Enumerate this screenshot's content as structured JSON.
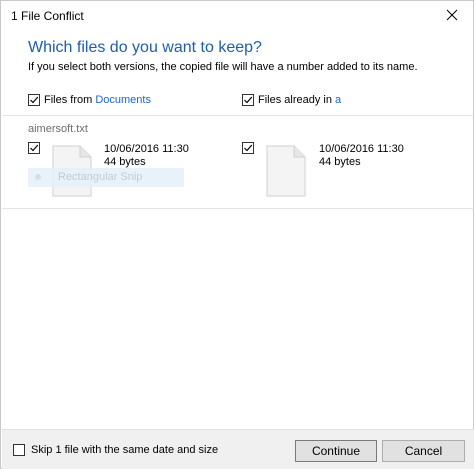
{
  "window": {
    "title": "1 File Conflict"
  },
  "header": {
    "heading": "Which files do you want to keep?",
    "subheading": "If you select both versions, the copied file will have a number added to its name."
  },
  "columns": {
    "left": {
      "prefix": "Files from ",
      "link": "Documents",
      "checked": true
    },
    "right": {
      "prefix": "Files already in ",
      "link": "a",
      "checked": true
    }
  },
  "conflict": {
    "filename": "aimersoft.txt",
    "left": {
      "date": "10/06/2016 11:30",
      "size": "44 bytes",
      "checked": true
    },
    "right": {
      "date": "10/06/2016 11:30",
      "size": "44 bytes",
      "checked": true
    },
    "overlay_label": "Rectangular Snip"
  },
  "footer": {
    "skip_label": "Skip 1 file with the same date and size",
    "skip_checked": false,
    "continue_label": "Continue",
    "cancel_label": "Cancel"
  },
  "colors": {
    "heading": "#1d5fa8",
    "link": "#1a66c2"
  }
}
